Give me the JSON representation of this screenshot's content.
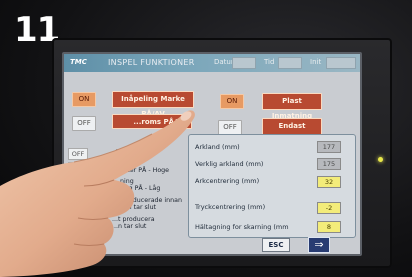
{
  "step_number": "11",
  "colors": {
    "screen_bg": "#c9ccd1",
    "state_on": "#e79a63",
    "function_button": "#b84a31",
    "value_yellow": "#f3ec7a",
    "arrow_button": "#283c72",
    "led": "#e9e84a"
  },
  "screen": {
    "logo": "TMC",
    "title": "INSPEL FUNKTIONER",
    "titlebar_labels": [
      "Datum",
      "Tid",
      "Init"
    ],
    "buttons": [
      {
        "state": "ON",
        "label": "Inåpeling Marke PÅ/AV"
      },
      {
        "state": "ON",
        "label": "Plast Inmatning"
      },
      {
        "state": "OFF",
        "label": "...roms PÅ/AV"
      },
      {
        "state": "OFF",
        "label": "Endast Plastling"
      }
    ],
    "options": [
      {
        "state": "OFF",
        "text": "...lt, don"
      },
      {
        "state": "OFF",
        "text": "...tryck\n...ster PÅ - Hoge"
      },
      {
        "state": "",
        "text": "...ning\n...Hog PÅ - Låg"
      },
      {
        "state": "",
        "text": "...t producerade innan\n...sten tar slut"
      },
      {
        "state": "",
        "text": "...t producera\n...n tar slut"
      }
    ],
    "info_rows": [
      {
        "label": "Arkland (mm)",
        "value": "177",
        "style": "grey"
      },
      {
        "label": "Verklig arkland (mm)",
        "value": "175",
        "style": "grey"
      },
      {
        "label": "Arkcentrering (mm)",
        "value": "32",
        "style": "yellow"
      },
      {
        "label": "Tryckcentrering (mm)",
        "value": "-2",
        "style": "yellow"
      },
      {
        "label": "Hältagning for skarning (mm",
        "value": "8",
        "style": "yellow"
      }
    ],
    "esc_label": "ESC",
    "next_arrow": "⇒"
  }
}
